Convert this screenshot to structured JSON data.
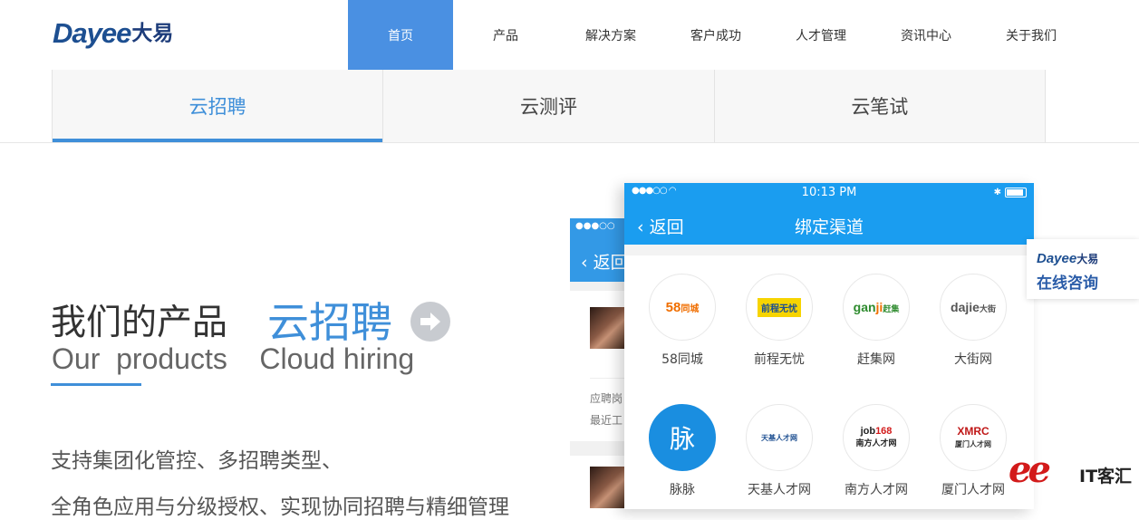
{
  "logo": {
    "latin": "Dayee",
    "cn": "大易"
  },
  "nav": {
    "items": [
      "首页",
      "产品",
      "解决方案",
      "客户成功",
      "人才管理",
      "资讯中心",
      "关于我们"
    ]
  },
  "tabs": [
    "云招聘",
    "云测评",
    "云笔试"
  ],
  "hero": {
    "title_cn": "我们的产品",
    "product_cn": "云招聘",
    "subtitle_en": "Our  products    Cloud hiring",
    "desc_line1": "支持集团化管控、多招聘类型、",
    "desc_line2": "全角色应用与分级授权、实现协同招聘与精细管理"
  },
  "phone_back": {
    "status": "●●●○○",
    "back_label": "返回",
    "meta1": "应聘岗",
    "meta2": "最近工"
  },
  "phone_front": {
    "status_dots": "●●●○○",
    "time": "10:13 PM",
    "back_label": "返回",
    "title": "绑定渠道",
    "channels": [
      {
        "name": "58同城",
        "logo": "58同城"
      },
      {
        "name": "前程无忧",
        "logo": "前程无忧"
      },
      {
        "name": "赶集网",
        "logo": "ganji 赶集"
      },
      {
        "name": "大街网",
        "logo": "dajie 大街"
      },
      {
        "name": "脉脉",
        "logo": "脉"
      },
      {
        "name": "天基人才网",
        "logo": "天基人才网"
      },
      {
        "name": "南方人才网",
        "logo": "job168 南方人才网"
      },
      {
        "name": "厦门人才网",
        "logo": "XMRC 厦门人才网"
      }
    ]
  },
  "consult": {
    "logo_latin": "Dayee",
    "logo_cn": "大易",
    "label": "在线咨询"
  },
  "watermark": {
    "mark": "ee",
    "text": "IT客汇"
  },
  "colors": {
    "accent": "#4a90e2",
    "tab_active": "#3f8fd9",
    "app_blue": "#1a9df0"
  }
}
